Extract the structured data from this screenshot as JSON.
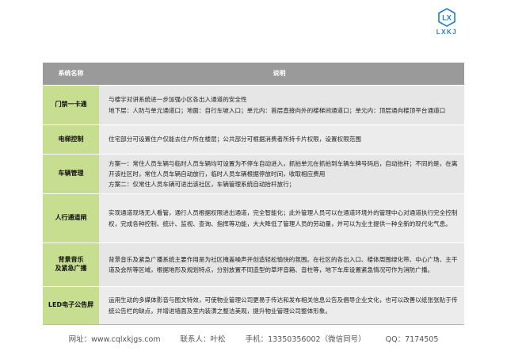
{
  "logo": {
    "mark": "LX",
    "text": "LXKJ",
    "color": "#1f7fc8"
  },
  "table": {
    "headers": {
      "name": "系统名称",
      "desc": "说明"
    },
    "rows": [
      {
        "name": "门禁一卡通",
        "lines": [
          "与楼宇对讲系统进一步加强小区各出入通道的安全性",
          "地下层：人防与单元通道口；地面：自行车坡入口；单元内：首层直接向外的楼梯间通道口；单元内：顶层通向楼顶平台通道口"
        ]
      },
      {
        "name": "电梯控制",
        "lines": [
          "住宅部分可设置住户仅能去住户所在楼层；公共部分可根据消费者所持卡片权限，设置权限范围"
        ]
      },
      {
        "name": "车辆管理",
        "lines": [
          "方案一：常住人员车辆与临时人员车辆均可设置为不停车自动进入，抓拍单元在抓拍到车辆车牌号码后，自动抬杆；不同的是，在离开该社区时，常住人员车辆自动放行，临时人员车辆根据停放时间，收取相应费用",
          "方案二：仅常住人员车辆可进出该社区，车辆管理系统自动抬杆放行；"
        ]
      },
      {
        "name": "人行通道闸",
        "lines": [
          "实现通道现场无人看管，通行人员根据权限进出通道，完全智能化；此外管理人员可以在通道环境外的管理中心对通道执行完全控制权，完成各种控制、统计、监视、查询、指挥等功能，大大降低了管理人员的劳动量，并可以为业主提供一种全新的现代化气息。"
        ]
      },
      {
        "name": "背景音乐及紧急广播",
        "name_line1": "背景音乐",
        "name_line2": "及紧急广播",
        "lines": [
          "背景音乐及紧急广播系统主要作用是为社区掩盖噪声并创造轻松愉快的氛围。在社区的各出入口、楼体周围绿化带、中心广场、主干道及会所等区域，根据地形及规划特点，分别放置不同造型的草坪音箱、音柱等，地下车库设置紧急情况可作为消防广播。"
        ]
      },
      {
        "name": "LED电子公告屏",
        "lines": [
          "运用生动的多媒体影音与图文特效，可使物业管理公司更易于传达和发布相关信息公告及倡导企业文化，也可以改善以纸张张贴于传统公告栏的缺点，并增进墙面及室内装潢之整洁美观，提升物业管理公司整体形象。"
        ]
      }
    ]
  },
  "footer": {
    "website": "网址：www.cqlxkjgs.com",
    "contact": "联系人：叶松",
    "phone": "手机：13350356002（微信同号）",
    "qq": "QQ：7174505"
  }
}
